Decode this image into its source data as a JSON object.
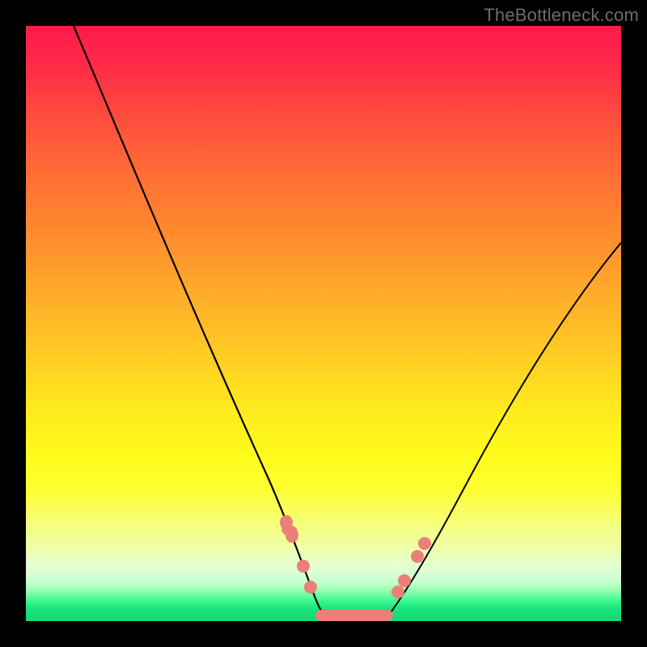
{
  "watermark": "TheBottleneck.com",
  "colors": {
    "bead": "#ec7f77",
    "curve": "#000000",
    "frame": "#000000"
  },
  "chart_data": {
    "type": "line",
    "title": "",
    "xlabel": "",
    "ylabel": "",
    "xlim": [
      0,
      100
    ],
    "ylim": [
      0,
      100
    ],
    "legend": false,
    "background": "gradient red→yellow→green (top→bottom)",
    "series": [
      {
        "name": "left-curve",
        "x": [
          8,
          12,
          16,
          20,
          24,
          28,
          32,
          36,
          40,
          44,
          47,
          49
        ],
        "y": [
          100,
          91,
          82,
          73,
          64,
          55,
          46,
          37,
          27,
          16,
          7,
          2
        ]
      },
      {
        "name": "right-curve",
        "x": [
          61,
          64,
          68,
          72,
          76,
          80,
          84,
          88,
          92,
          96,
          100
        ],
        "y": [
          2,
          7,
          14,
          21,
          28,
          35,
          42,
          49,
          55,
          60,
          64
        ]
      },
      {
        "name": "valley-floor",
        "x": [
          49,
          61
        ],
        "y": [
          0.5,
          0.5
        ]
      }
    ],
    "annotations": {
      "beads_left": [
        {
          "x": 44.0,
          "y": 16
        },
        {
          "x": 45.4,
          "y": 13
        },
        {
          "x": 47.0,
          "y": 8
        },
        {
          "x": 48.2,
          "y": 4
        }
      ],
      "beads_right": [
        {
          "x": 62.2,
          "y": 4
        },
        {
          "x": 63.2,
          "y": 6
        },
        {
          "x": 65.5,
          "y": 10
        },
        {
          "x": 66.8,
          "y": 12
        }
      ],
      "floor_bar": {
        "x0": 48.5,
        "x1": 61.5,
        "y": 0.7
      }
    }
  }
}
